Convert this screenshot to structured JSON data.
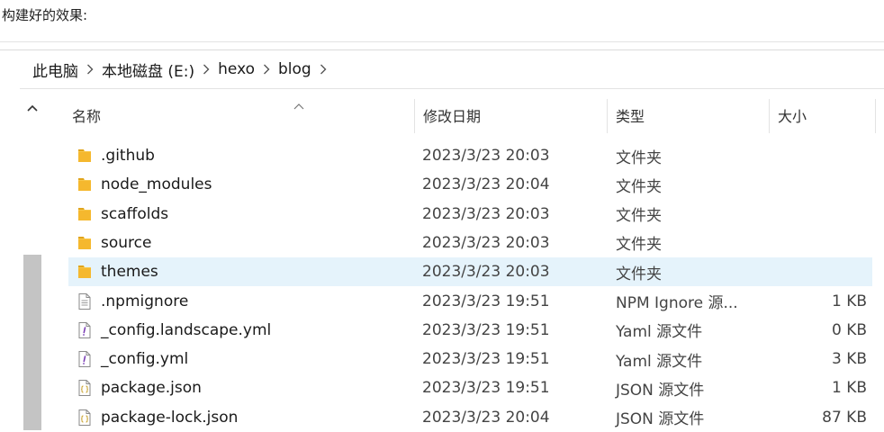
{
  "caption": "构建好的效果:",
  "breadcrumb": [
    "此电脑",
    "本地磁盘 (E:)",
    "hexo",
    "blog"
  ],
  "columns": {
    "name": "名称",
    "date": "修改日期",
    "type": "类型",
    "size": "大小"
  },
  "files": [
    {
      "name": ".github",
      "date": "2023/3/23 20:03",
      "type": "文件夹",
      "size": "",
      "icon": "folder-icon",
      "selected": false
    },
    {
      "name": "node_modules",
      "date": "2023/3/23 20:04",
      "type": "文件夹",
      "size": "",
      "icon": "folder-icon",
      "selected": false
    },
    {
      "name": "scaffolds",
      "date": "2023/3/23 20:03",
      "type": "文件夹",
      "size": "",
      "icon": "folder-icon",
      "selected": false
    },
    {
      "name": "source",
      "date": "2023/3/23 20:03",
      "type": "文件夹",
      "size": "",
      "icon": "folder-icon",
      "selected": false
    },
    {
      "name": "themes",
      "date": "2023/3/23 20:03",
      "type": "文件夹",
      "size": "",
      "icon": "folder-icon",
      "selected": true
    },
    {
      "name": ".npmignore",
      "date": "2023/3/23 19:51",
      "type": "NPM Ignore 源...",
      "size": "1 KB",
      "icon": "text-file-icon",
      "selected": false
    },
    {
      "name": "_config.landscape.yml",
      "date": "2023/3/23 19:51",
      "type": "Yaml 源文件",
      "size": "0 KB",
      "icon": "yaml-file-icon",
      "selected": false
    },
    {
      "name": "_config.yml",
      "date": "2023/3/23 19:51",
      "type": "Yaml 源文件",
      "size": "3 KB",
      "icon": "yaml-file-icon",
      "selected": false
    },
    {
      "name": "package.json",
      "date": "2023/3/23 19:51",
      "type": "JSON 源文件",
      "size": "1 KB",
      "icon": "json-file-icon",
      "selected": false
    },
    {
      "name": "package-lock.json",
      "date": "2023/3/23 20:04",
      "type": "JSON 源文件",
      "size": "87 KB",
      "icon": "json-file-icon",
      "selected": false
    }
  ],
  "colors": {
    "selected_row": "#e5f3fb",
    "folder": "#f8c74a",
    "yaml_accent": "#7a3fb5",
    "json_accent": "#c8a02a"
  }
}
